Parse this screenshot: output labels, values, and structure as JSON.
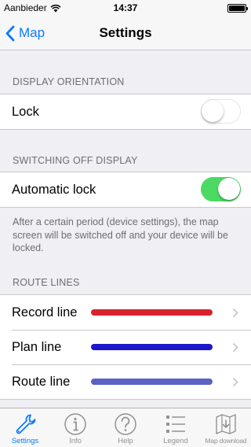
{
  "status_bar": {
    "carrier": "Aanbieder",
    "time": "14:37"
  },
  "nav": {
    "back_label": "Map",
    "title": "Settings"
  },
  "sections": {
    "display_orientation": {
      "header": "DISPLAY ORIENTATION",
      "lock_label": "Lock",
      "lock_on": false
    },
    "switching_off": {
      "header": "SWITCHING OFF DISPLAY",
      "auto_lock_label": "Automatic lock",
      "auto_lock_on": true,
      "note": "After a certain period (device settings), the map screen will be switched off and your device will be locked."
    },
    "route_lines": {
      "header": "ROUTE LINES",
      "items": [
        {
          "label": "Record line",
          "color": "#d8232f"
        },
        {
          "label": "Plan line",
          "color": "#1c17c9"
        },
        {
          "label": "Route line",
          "color": "#5b62c4"
        }
      ]
    }
  },
  "tab_bar": {
    "tabs": [
      {
        "label": "Settings",
        "icon": "wrench-icon",
        "active": true
      },
      {
        "label": "Info",
        "icon": "info-icon",
        "active": false
      },
      {
        "label": "Help",
        "icon": "help-icon",
        "active": false
      },
      {
        "label": "Legend",
        "icon": "legend-list-icon",
        "active": false
      },
      {
        "label": "Map download",
        "icon": "map-download-icon",
        "active": false
      }
    ]
  },
  "colors": {
    "accent": "#0a7aff",
    "toggle_on": "#4cd964",
    "background": "#efeff4"
  }
}
